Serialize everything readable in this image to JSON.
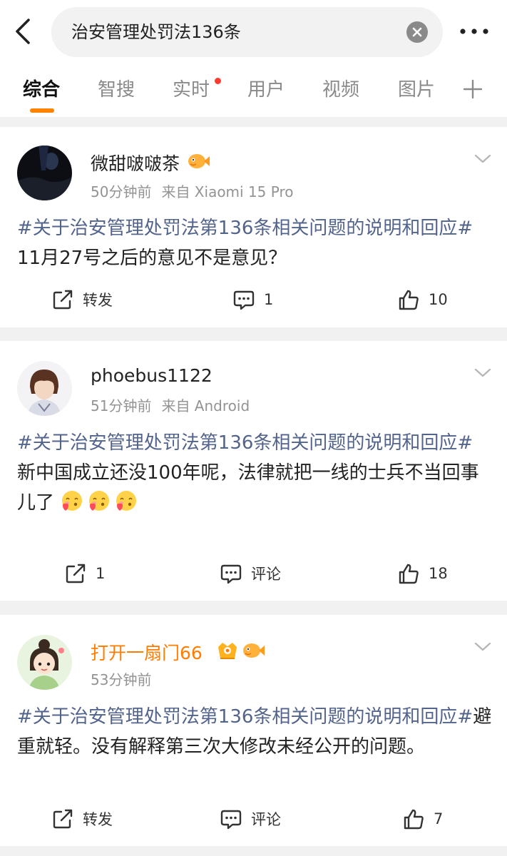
{
  "search": {
    "query": "治安管理处罚法136条"
  },
  "tabs": [
    {
      "label": "综合"
    },
    {
      "label": "智搜"
    },
    {
      "label": "实时"
    },
    {
      "label": "用户"
    },
    {
      "label": "视频"
    },
    {
      "label": "图片"
    }
  ],
  "posts": [
    {
      "username": "微甜啵啵茶",
      "time": "50分钟前",
      "source": "来自 Xiaomi 15 Pro",
      "topic": "#关于治安管理处罚法第136条相关问题的说明和回应#",
      "text": " 11月27号之后的意见不是意见？",
      "repost": "转发",
      "comment": "1",
      "like": "10"
    },
    {
      "username": "phoebus1122",
      "time": "51分钟前",
      "source": "来自 Android",
      "topic": "#关于治安管理处罚法第136条相关问题的说明和回应#",
      "text": "新中国成立还没100年呢，法律就把一线的士兵不当回事儿了",
      "repost": "1",
      "comment": "评论",
      "like": "18"
    },
    {
      "username": "打开一扇门66",
      "time": "53分钟前",
      "source": "",
      "topic": "#关于治安管理处罚法第136条相关问题的说明和回应#",
      "text": "避重就轻。没有解释第三次大修改未经公开的问题。",
      "repost": "转发",
      "comment": "评论",
      "like": "7"
    }
  ],
  "colors": {
    "accent_orange": "#ff8200",
    "topic_link": "#53648c",
    "vip_name": "#ff7c00",
    "notification_dot": "#ff3b30"
  },
  "icons": [
    "back-icon",
    "clear-icon",
    "more-icon",
    "plus-icon",
    "chevron-down-icon",
    "repost-icon",
    "comment-icon",
    "like-icon",
    "fish-badge-icon",
    "vip-badge-icon",
    "heart-face-emoji"
  ]
}
